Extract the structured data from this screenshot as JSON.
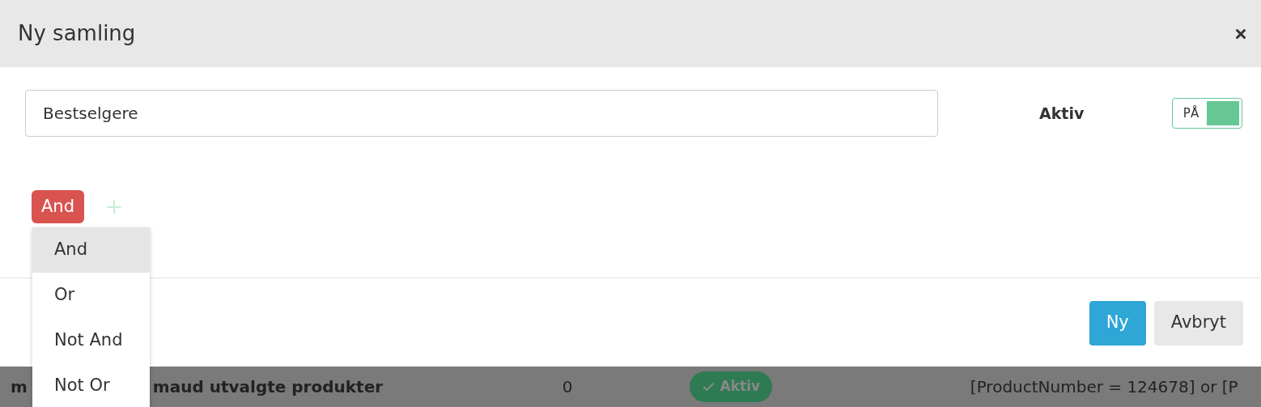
{
  "dialog": {
    "title": "Ny samling",
    "name_field": {
      "value": "Bestselgere"
    },
    "active": {
      "label": "Aktiv",
      "toggle": {
        "label": "PÅ",
        "on": true
      }
    },
    "operator_button": "And",
    "operator_menu": [
      {
        "label": "And",
        "selected": true
      },
      {
        "label": "Or",
        "selected": false
      },
      {
        "label": "Not And",
        "selected": false
      },
      {
        "label": "Not Or",
        "selected": false
      }
    ],
    "buttons": [
      {
        "label": "Ny",
        "kind": "primary"
      },
      {
        "label": "Avbryt",
        "kind": "secondary"
      }
    ]
  },
  "background_row": {
    "name_start": "m",
    "name": "maud utvalgte produkter",
    "count": "0",
    "status": {
      "label": "Aktiv"
    },
    "rule": "[ProductNumber = 124678] or [P"
  }
}
